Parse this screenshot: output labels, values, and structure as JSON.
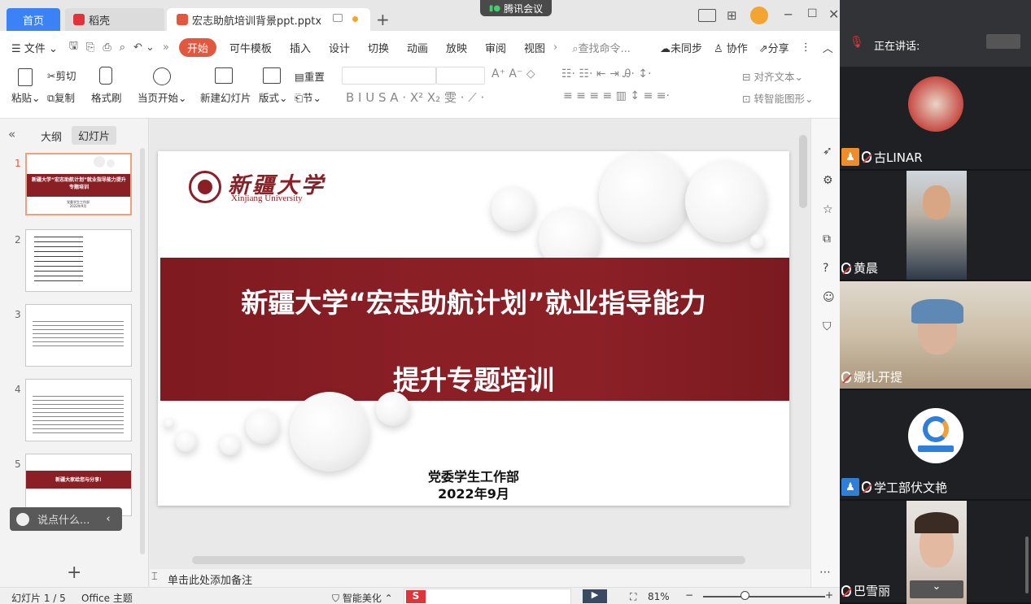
{
  "tabs": {
    "home": "首页",
    "daoke": "稻壳",
    "document": "宏志助航培训背景ppt.pptx",
    "meeting_app": "腾讯会议"
  },
  "menu": {
    "file": "文件",
    "items": [
      "开始",
      "可牛模板",
      "插入",
      "设计",
      "切换",
      "动画",
      "放映",
      "审阅",
      "视图"
    ],
    "search": "查找命令...",
    "sync": "未同步",
    "collab": "协作",
    "share": "分享"
  },
  "ribbon": {
    "paste": "粘贴",
    "cut": "剪切",
    "copy": "复制",
    "format_painter": "格式刷",
    "play_current": "当页开始",
    "new_slide": "新建幻灯片",
    "layout": "版式",
    "reset": "重置",
    "section": "节",
    "align_text": "对齐文本",
    "smart_art": "转智能图形"
  },
  "left_panel": {
    "outline_tab": "大纲",
    "slides_tab": "幻灯片",
    "thumbs": [
      {
        "num": "1",
        "title": "新疆大学“宏志助航计划”就业指导能力提升专题培训",
        "footer": "党委学生工作部\n2022年9月"
      },
      {
        "num": "2"
      },
      {
        "num": "3"
      },
      {
        "num": "4"
      },
      {
        "num": "5",
        "title": "新疆大家给您与分享!"
      }
    ],
    "comment_placeholder": "说点什么..."
  },
  "slide": {
    "university_cn": "新疆大学",
    "university_en": "Xinjiang University",
    "title_line1": "新疆大学“宏志助航计划”就业指导能力",
    "title_line2": "提升专题培训",
    "dept": "党委学生工作部",
    "date": "2022年9月",
    "accent_color": "#8a1f26"
  },
  "notes": {
    "placeholder": "单击此处添加备注"
  },
  "status": {
    "slide_pos": "幻灯片 1 / 5",
    "theme": "Office 主题",
    "beautify": "智能美化",
    "zoom": "81%"
  },
  "meeting": {
    "speaking_label": "正在讲话:",
    "participants": [
      {
        "name": "古LINAR"
      },
      {
        "name": "黄晨"
      },
      {
        "name": "娜扎开提"
      },
      {
        "name": "学工部伏文艳"
      },
      {
        "name": "巴雪丽"
      }
    ]
  }
}
